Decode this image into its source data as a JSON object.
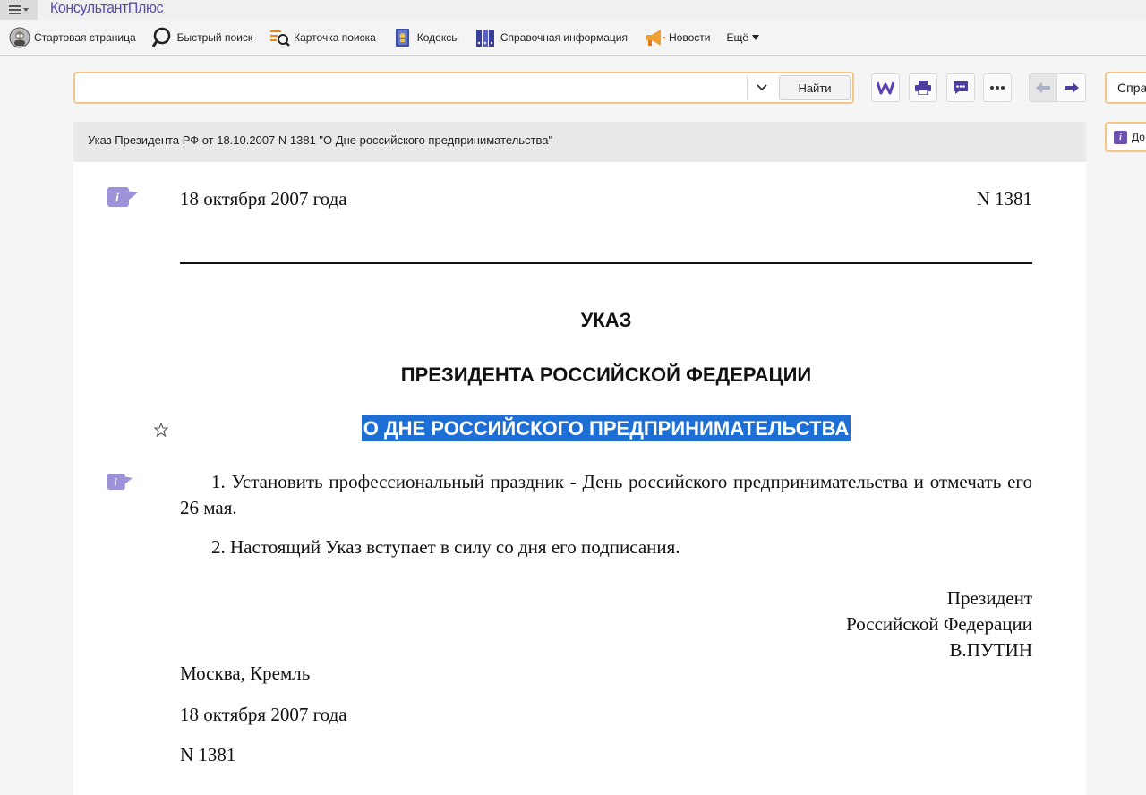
{
  "app": {
    "logo": "КонсультантПлюс"
  },
  "toolbar": {
    "items": [
      {
        "label": "Стартовая страница",
        "icon": "start-page-icon"
      },
      {
        "label": "Быстрый поиск",
        "icon": "search-icon"
      },
      {
        "label": "Карточка поиска",
        "icon": "search-card-icon"
      },
      {
        "label": "Кодексы",
        "icon": "codex-icon"
      },
      {
        "label": "Справочная информация",
        "icon": "reference-icon"
      },
      {
        "label": "Новости",
        "icon": "megaphone-icon"
      },
      {
        "label": "Ещё",
        "icon": "chevron-down-icon"
      }
    ]
  },
  "search": {
    "value": "",
    "placeholder": "",
    "button_label": "Найти"
  },
  "right_panel": {
    "field_text": "Спра",
    "badge_text": "До"
  },
  "document": {
    "header_title": "Указ Президента РФ от 18.10.2007 N 1381 \"О Дне российского предпринимательства\"",
    "date_top": "18 октября 2007 года",
    "number_top": "N 1381",
    "heading1": "УКАЗ",
    "heading2": "ПРЕЗИДЕНТА РОССИЙСКОЙ ФЕДЕРАЦИИ",
    "heading3": "О ДНЕ РОССИЙСКОГО ПРЕДПРИНИМАТЕЛЬСТВА",
    "paragraph1": "1. Установить профессиональный праздник - День российского предпринимательства и отмечать его 26 мая.",
    "paragraph2": "2. Настоящий Указ вступает в силу со дня его подписания.",
    "signature": {
      "line1": "Президент",
      "line2": "Российской Федерации",
      "line3": "В.ПУТИН"
    },
    "place": "Москва, Кремль",
    "date_bottom": "18 октября 2007 года",
    "number_bottom": "N 1381"
  },
  "colors": {
    "accent": "#5b4aa8",
    "search_border": "#f4c788",
    "selection": "#1d6fd6"
  }
}
